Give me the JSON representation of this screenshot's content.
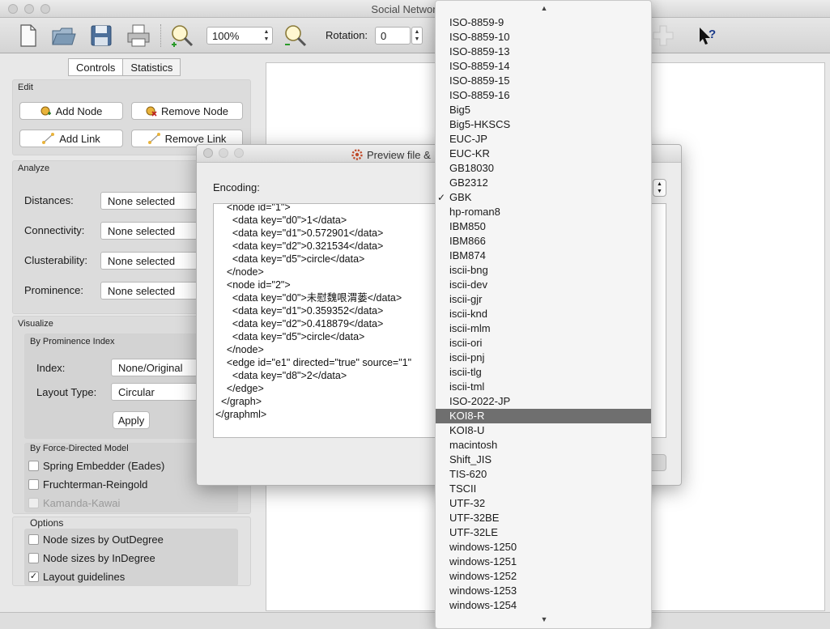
{
  "window": {
    "title": "Social Network Vis"
  },
  "toolbar": {
    "zoom": "100%",
    "rotation_label": "Rotation:",
    "rotation_value": "0",
    "icons": [
      "new-file-icon",
      "open-folder-icon",
      "save-disk-icon",
      "print-icon",
      "zoom-in-icon",
      "zoom-out-icon",
      "add-icon",
      "help-icon"
    ]
  },
  "tabs": [
    "Controls",
    "Statistics"
  ],
  "edit": {
    "title": "Edit",
    "add_node": "Add Node",
    "remove_node": "Remove Node",
    "add_link": "Add Link",
    "remove_link": "Remove Link"
  },
  "analyze": {
    "title": "Analyze",
    "rows": [
      {
        "label": "Distances:",
        "value": "None selected"
      },
      {
        "label": "Connectivity:",
        "value": "None selected"
      },
      {
        "label": "Clusterability:",
        "value": "None selected"
      },
      {
        "label": "Prominence:",
        "value": "None selected"
      }
    ]
  },
  "visualize": {
    "title": "Visualize",
    "prominence_title": "By Prominence Index",
    "index_label": "Index:",
    "index_value": "None/Original",
    "layout_label": "Layout Type:",
    "layout_value": "Circular",
    "apply": "Apply",
    "force_title": "By Force-Directed Model",
    "force_options": [
      {
        "label": "Spring Embedder (Eades)",
        "checked": false,
        "disabled": false
      },
      {
        "label": "Fruchterman-Reingold",
        "checked": false,
        "disabled": false
      },
      {
        "label": "Kamanda-Kawai",
        "checked": false,
        "disabled": true
      }
    ]
  },
  "options": {
    "title": "Options",
    "items": [
      {
        "label": "Node sizes by OutDegree",
        "checked": false
      },
      {
        "label": "Node sizes by InDegree",
        "checked": false
      },
      {
        "label": "Layout guidelines",
        "checked": true
      }
    ]
  },
  "dialog": {
    "title": "Preview file &",
    "encoding_label": "Encoding:",
    "xml_lines": [
      "    <node id=\"1\">",
      "      <data key=\"d0\">1</data>",
      "      <data key=\"d1\">0.572901</data>",
      "      <data key=\"d2\">0.321534</data>",
      "      <data key=\"d5\">circle</data>",
      "    </node>",
      "    <node id=\"2\">",
      "      <data key=\"d0\">未慰魏哏渭蒌</data>",
      "      <data key=\"d1\">0.359352</data>",
      "      <data key=\"d2\">0.418879</data>",
      "      <data key=\"d5\">circle</data>",
      "    </node>",
      "    <edge id=\"e1\" directed=\"true\" source=\"1\"",
      "      <data key=\"d8\">2</data>",
      "    </edge>",
      "  </graph>",
      "</graphml>"
    ]
  },
  "encoding_menu": {
    "checked": "GBK",
    "highlighted": "KOI8-R",
    "items": [
      "ISO-8859-9",
      "ISO-8859-10",
      "ISO-8859-13",
      "ISO-8859-14",
      "ISO-8859-15",
      "ISO-8859-16",
      "Big5",
      "Big5-HKSCS",
      "EUC-JP",
      "EUC-KR",
      "GB18030",
      "GB2312",
      "GBK",
      "hp-roman8",
      "IBM850",
      "IBM866",
      "IBM874",
      "iscii-bng",
      "iscii-dev",
      "iscii-gjr",
      "iscii-knd",
      "iscii-mlm",
      "iscii-ori",
      "iscii-pnj",
      "iscii-tlg",
      "iscii-tml",
      "ISO-2022-JP",
      "KOI8-R",
      "KOI8-U",
      "macintosh",
      "Shift_JIS",
      "TIS-620",
      "TSCII",
      "UTF-32",
      "UTF-32BE",
      "UTF-32LE",
      "windows-1250",
      "windows-1251",
      "windows-1252",
      "windows-1253",
      "windows-1254"
    ]
  }
}
